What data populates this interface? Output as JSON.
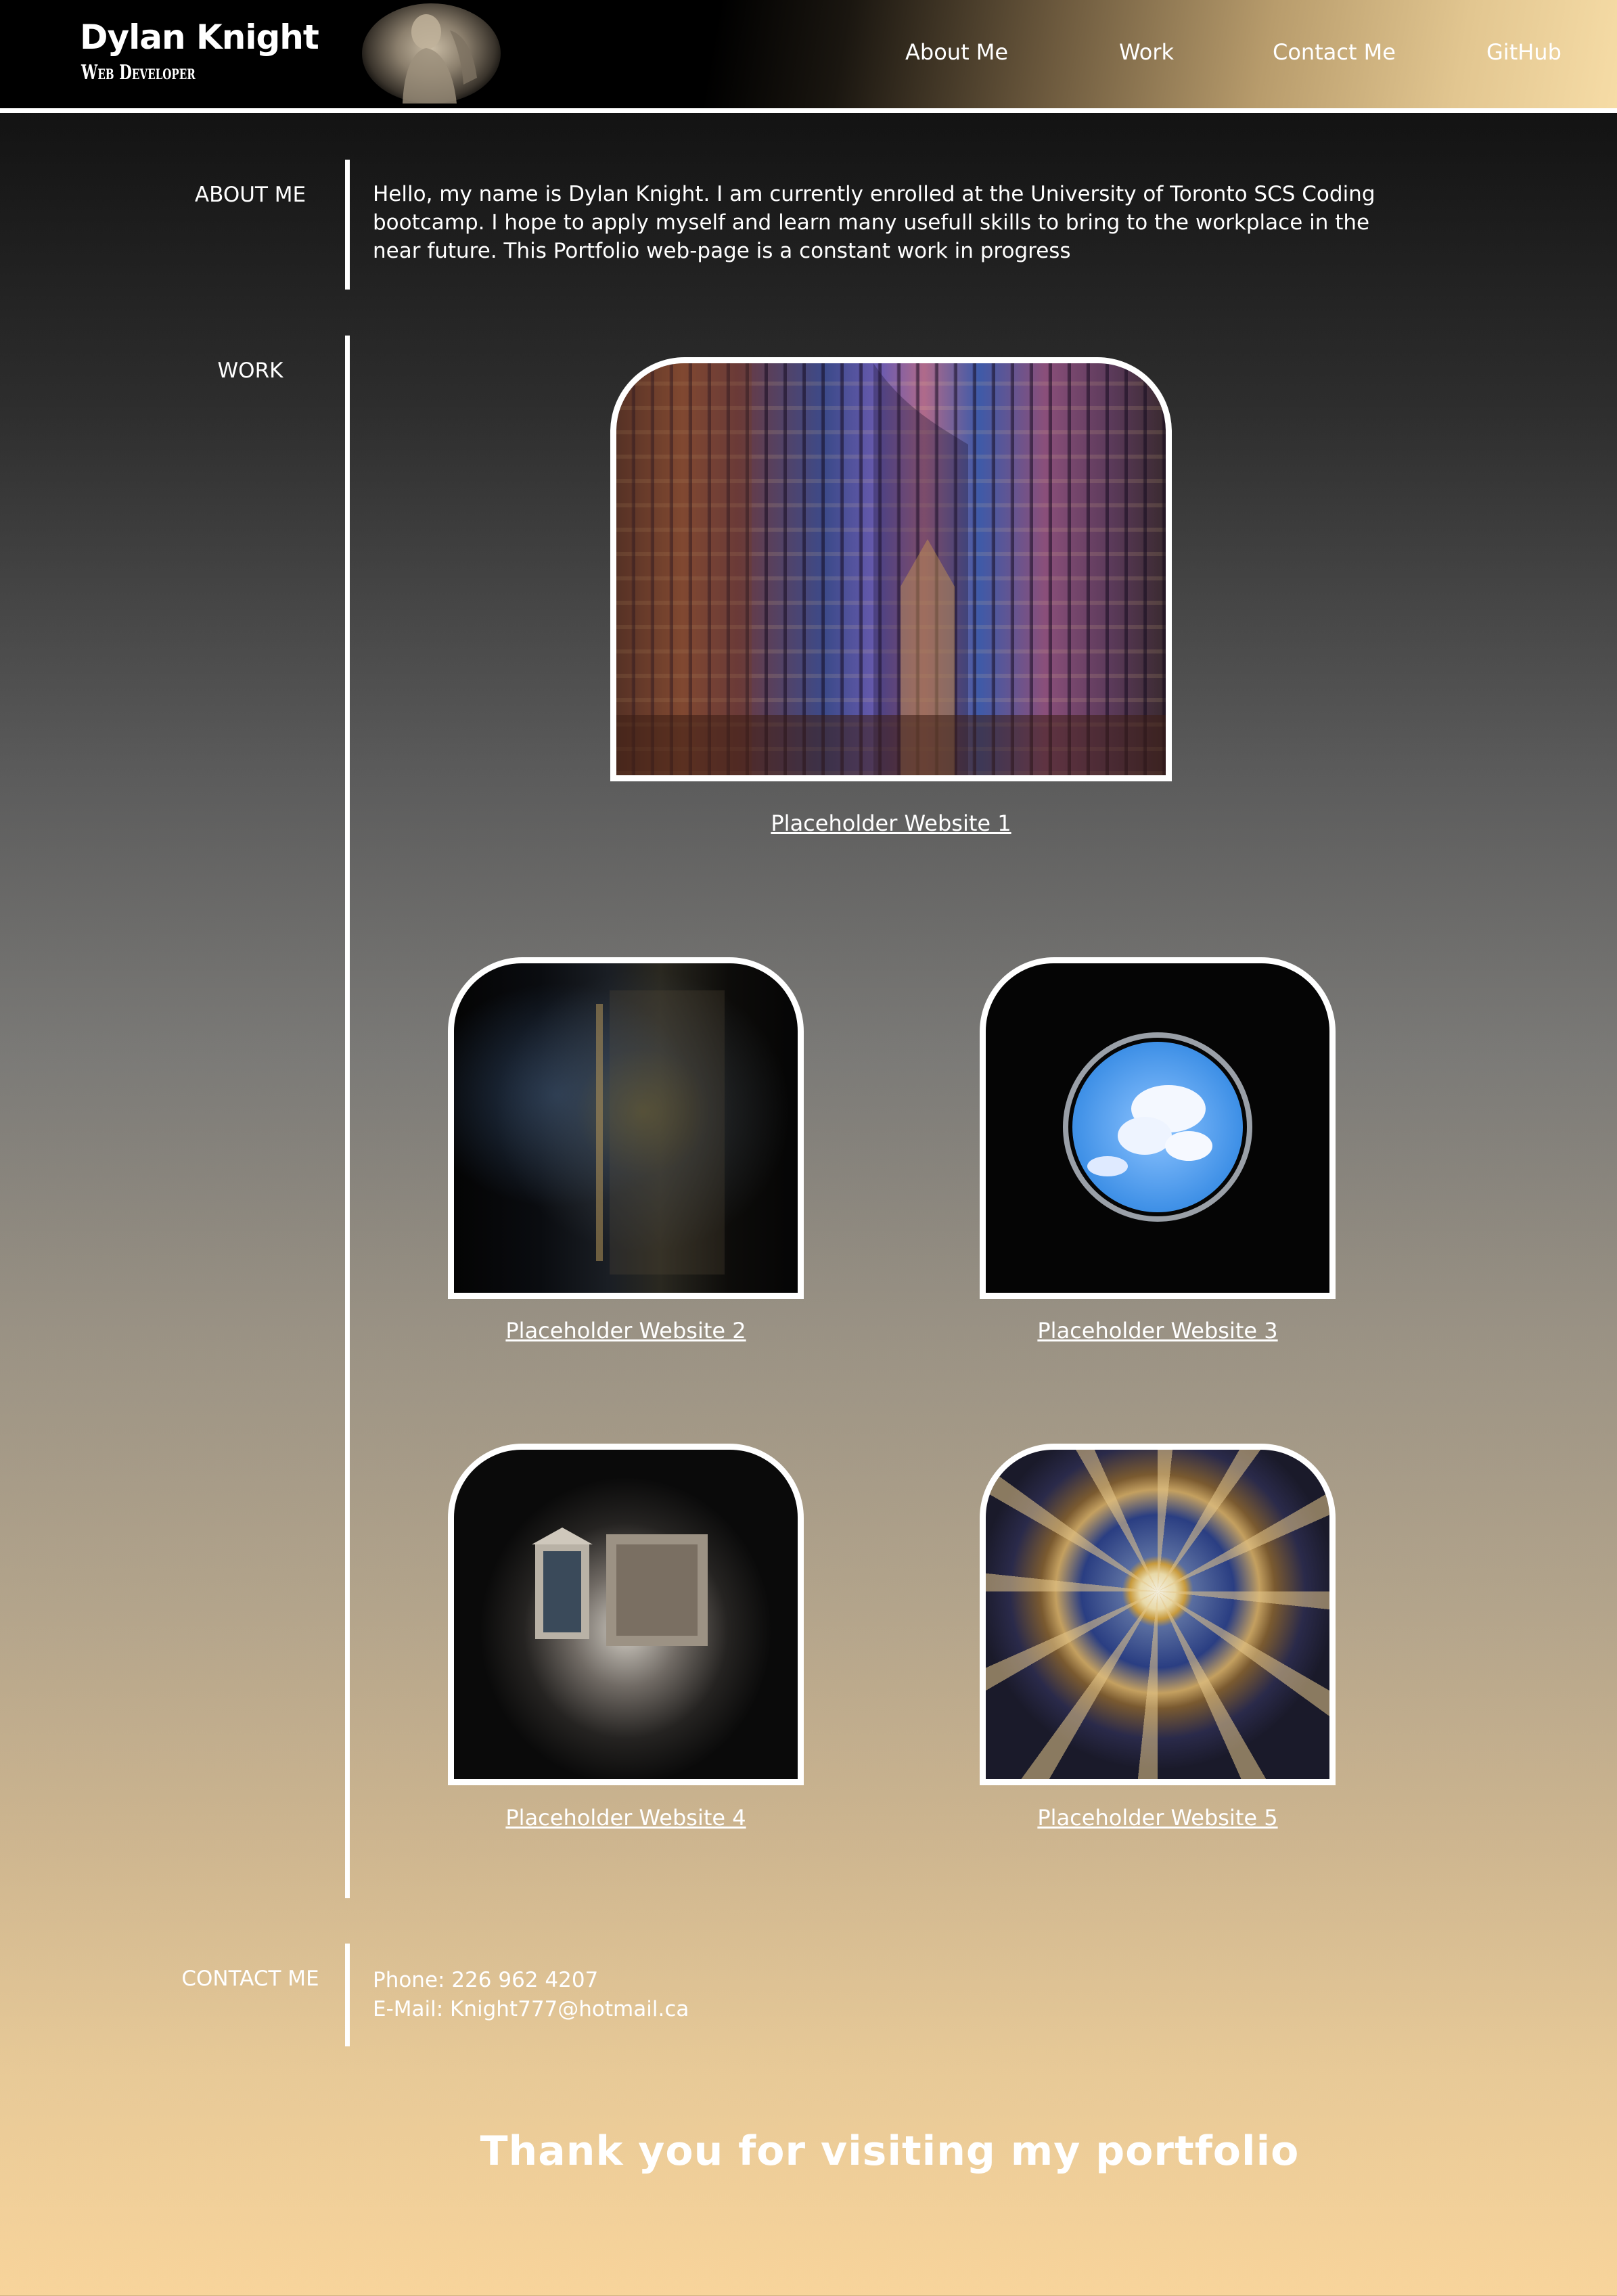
{
  "header": {
    "brand_name": "Dylan Knight",
    "brand_subtitle": "Web Developer",
    "nav": [
      "About Me",
      "Work",
      "Contact Me",
      "GitHub"
    ]
  },
  "about": {
    "label": "ABOUT ME",
    "text": "Hello, my name is Dylan Knight. I am currently enrolled at the University of Toronto SCS Coding bootcamp. I hope to apply myself and learn many usefull skills to bring to the workplace in the near future. This Portfolio web-page is a constant work in progress"
  },
  "work": {
    "label": "WORK",
    "projects": [
      {
        "title": "Placeholder Website 1",
        "image": "cathedral-stained-glass"
      },
      {
        "title": "Placeholder Website 2",
        "image": "dark-door"
      },
      {
        "title": "Placeholder Website 3",
        "image": "sky-oculus"
      },
      {
        "title": "Placeholder Website 4",
        "image": "pantheon-window"
      },
      {
        "title": "Placeholder Website 5",
        "image": "painted-dome"
      }
    ]
  },
  "contact": {
    "label": "CONTACT ME",
    "phone": "Phone: 226 962 4207",
    "email": "E-Mail: Knight777@hotmail.ca"
  },
  "footer": {
    "message": "Thank you for visiting my portfolio"
  },
  "colors": {
    "header_bg": "#000000",
    "accent_gold": "#f8d49b",
    "text": "#ffffff"
  }
}
